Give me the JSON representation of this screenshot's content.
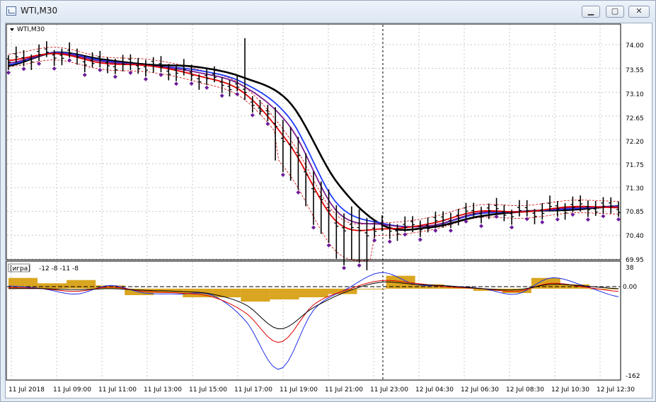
{
  "window": {
    "title": "WTI,M30",
    "minimize_icon": "minimize-icon",
    "maximize_icon": "restore-icon",
    "close_icon": "close-icon"
  },
  "main_chart": {
    "symbol_label": "WTI,M30",
    "price_ticks": [
      "74.00",
      "73.55",
      "73.10",
      "72.65",
      "72.20",
      "71.75",
      "71.30",
      "70.85",
      "70.40",
      "69.95"
    ],
    "colors": {
      "black_ma": "#000000",
      "blue_ma": "#1e3cff",
      "purple_ma": "#7a1f8c",
      "red_ma": "#e00000",
      "bands": "#cc0000",
      "markers": "#6a1b9a",
      "price_bars": "#000000"
    }
  },
  "indicator": {
    "label": "[игра]",
    "values_text": "-12 -8 -11 -8",
    "scale_top": "38",
    "scale_zero": "0.00",
    "scale_bottom": "-162",
    "colors": {
      "histogram": "#daa520",
      "blue_line": "#1e2ee6",
      "red_line": "#e00000",
      "black_line": "#000000"
    }
  },
  "time_axis": [
    "11 Jul 2018",
    "11 Jul 09:00",
    "11 Jul 11:00",
    "11 Jul 13:00",
    "11 Jul 15:00",
    "11 Jul 17:00",
    "11 Jul 19:00",
    "11 Jul 21:00",
    "11 Jul 23:00",
    "12 Jul 04:30",
    "12 Jul 06:30",
    "12 Jul 08:30",
    "12 Jul 10:30",
    "12 Jul 12:30"
  ],
  "chart_data": {
    "type": "line",
    "title": "WTI,M30",
    "x": [
      "11 Jul 2018",
      "11 Jul 09:00",
      "11 Jul 11:00",
      "11 Jul 13:00",
      "11 Jul 15:00",
      "11 Jul 17:00",
      "11 Jul 19:00",
      "11 Jul 21:00",
      "11 Jul 23:00",
      "12 Jul 04:30",
      "12 Jul 06:30",
      "12 Jul 08:30",
      "12 Jul 10:30",
      "12 Jul 12:30"
    ],
    "ylim": [
      69.95,
      74.0
    ],
    "series": [
      {
        "values": [
          73.6,
          73.85,
          73.72,
          73.62,
          73.58,
          73.38,
          72.9,
          71.4,
          70.58,
          70.55,
          70.75,
          70.85,
          70.88,
          70.95
        ]
      },
      {
        "values": [
          73.62,
          73.85,
          73.7,
          73.6,
          73.52,
          73.28,
          72.6,
          71.0,
          70.62,
          70.58,
          70.8,
          70.85,
          70.9,
          70.95
        ]
      },
      {
        "values": [
          73.65,
          73.84,
          73.68,
          73.6,
          73.48,
          73.22,
          72.45,
          70.85,
          70.6,
          70.58,
          70.82,
          70.85,
          70.92,
          70.94
        ]
      },
      {
        "values": [
          73.7,
          73.83,
          73.65,
          73.6,
          73.42,
          73.1,
          72.1,
          70.65,
          70.52,
          70.62,
          70.85,
          70.84,
          70.94,
          70.92
        ]
      }
    ],
    "indicator": {
      "ylim": [
        -162,
        38
      ],
      "histogram": [
        10,
        5,
        8,
        3,
        -6,
        -4,
        -8,
        -8,
        -12,
        -10,
        -8,
        -5,
        0,
        12,
        4,
        2,
        -2,
        -4,
        10,
        4,
        0
      ],
      "line_blue": [
        5,
        0,
        -10,
        6,
        -8,
        -10,
        -12,
        -60,
        -150,
        -40,
        0,
        30,
        8,
        5,
        0,
        -10,
        20,
        5,
        -15
      ],
      "line_red": [
        2,
        0,
        -5,
        3,
        -5,
        -8,
        -15,
        -45,
        -100,
        -30,
        -2,
        15,
        10,
        3,
        0,
        -5,
        10,
        3,
        -5
      ],
      "line_black": [
        0,
        0,
        -2,
        0,
        -3,
        -5,
        -10,
        -30,
        -75,
        -35,
        -5,
        12,
        8,
        5,
        0,
        -2,
        8,
        5,
        0
      ]
    }
  }
}
